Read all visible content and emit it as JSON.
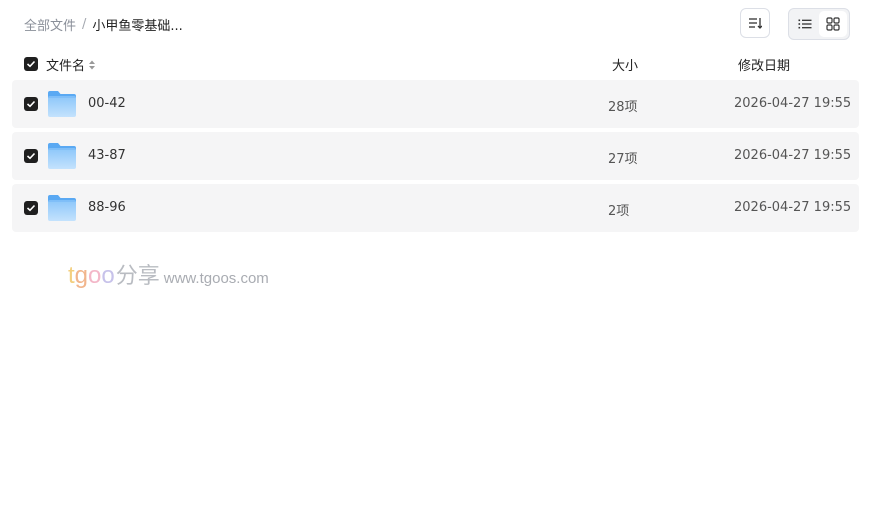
{
  "breadcrumb": {
    "root": "全部文件",
    "separator": "/",
    "current": "小甲鱼零基础..."
  },
  "toolbar": {
    "sort_icon": "sort-icon",
    "view_list_icon": "list-view-icon",
    "view_grid_icon": "grid-view-icon",
    "active_view": "grid"
  },
  "table": {
    "headers": {
      "name": "文件名",
      "size": "大小",
      "date": "修改日期"
    },
    "select_all_checked": true,
    "rows": [
      {
        "name": "00-42",
        "size": "28项",
        "date": "2026-04-27 19:55",
        "checked": true,
        "icon": "folder-icon"
      },
      {
        "name": "43-87",
        "size": "27项",
        "date": "2026-04-27 19:55",
        "checked": true,
        "icon": "folder-icon"
      },
      {
        "name": "88-96",
        "size": "2项",
        "date": "2026-04-27 19:55",
        "checked": true,
        "icon": "folder-icon"
      }
    ]
  },
  "watermark": {
    "brand_t": "t",
    "brand_g": "g",
    "brand_o1": "o",
    "brand_o2": "o",
    "share": "分享",
    "url": "www.tgoos.com"
  },
  "colors": {
    "row_bg": "#f5f5f6",
    "checkbox": "#1f1f1f",
    "folder_light": "#a9d4fb",
    "folder_dark": "#5aa9f3"
  }
}
